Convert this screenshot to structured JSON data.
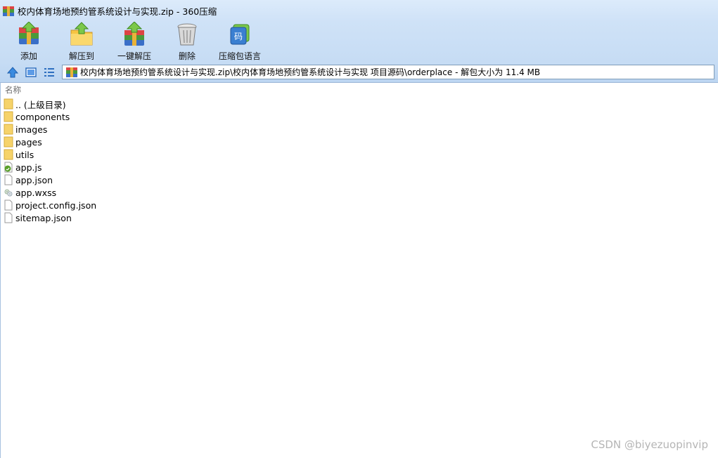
{
  "window": {
    "title": "校内体育场地预约管系统设计与实现.zip - 360压缩"
  },
  "toolbar": {
    "buttons": [
      {
        "label": "添加",
        "icon": "add-archive-icon"
      },
      {
        "label": "解压到",
        "icon": "extract-to-icon"
      },
      {
        "label": "一键解压",
        "icon": "one-click-extract-icon"
      },
      {
        "label": "删除",
        "icon": "delete-trash-icon"
      },
      {
        "label": "压缩包语言",
        "icon": "archive-language-icon"
      }
    ]
  },
  "navigation": {
    "up_icon": "up-arrow-icon",
    "view_icon": "view-mode-icon",
    "list_icon": "list-view-icon"
  },
  "address": {
    "path": "校内体育场地预约管系统设计与实现.zip\\校内体育场地预约管系统设计与实现 项目源码\\orderplace - 解包大小为 11.4 MB"
  },
  "file_list": {
    "column_name": "名称",
    "items": [
      {
        "name": ".. (上级目录)",
        "type": "folder"
      },
      {
        "name": "components",
        "type": "folder"
      },
      {
        "name": "images",
        "type": "folder"
      },
      {
        "name": "pages",
        "type": "folder"
      },
      {
        "name": "utils",
        "type": "folder"
      },
      {
        "name": "app.js",
        "type": "js"
      },
      {
        "name": "app.json",
        "type": "file"
      },
      {
        "name": "app.wxss",
        "type": "wxss"
      },
      {
        "name": "project.config.json",
        "type": "file"
      },
      {
        "name": "sitemap.json",
        "type": "file"
      }
    ]
  },
  "watermark": "CSDN @biyezuopinvip",
  "colors": {
    "titlebar": "#dcebfb",
    "toolbar": "#cfe2f7",
    "folder": "#f6d36a",
    "accent": "#3a7fd1"
  }
}
